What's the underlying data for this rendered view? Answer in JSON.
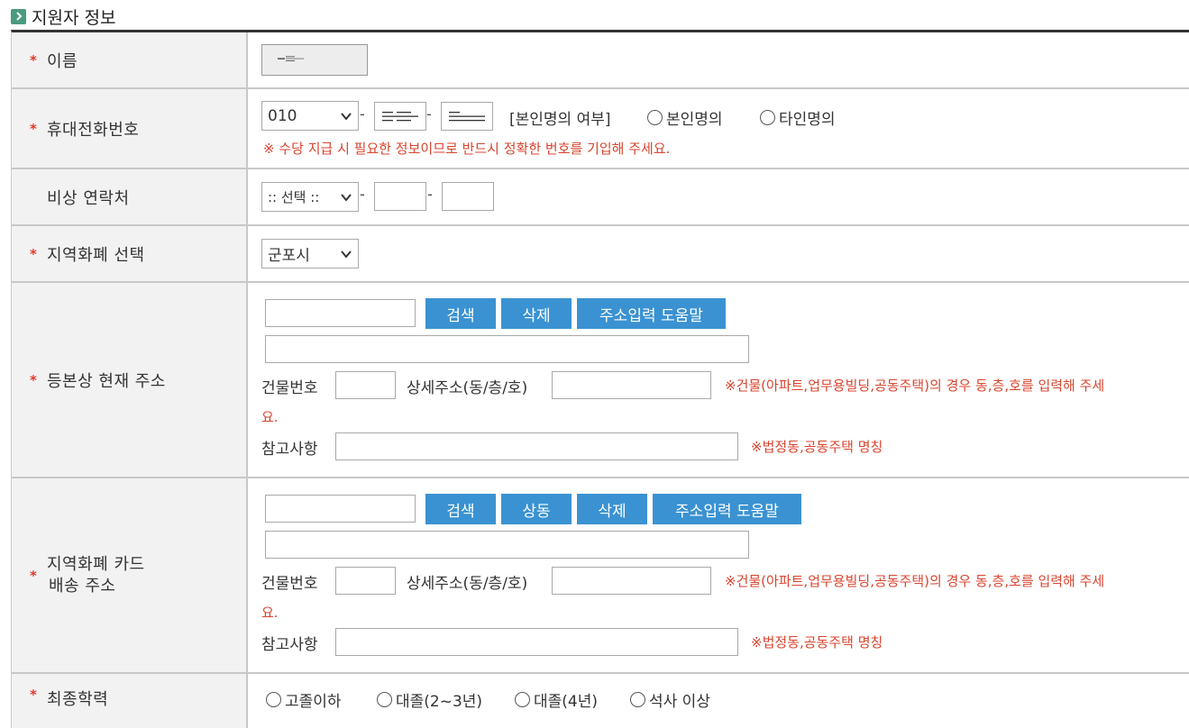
{
  "section": {
    "title": "지원자 정보"
  },
  "rows": {
    "name": {
      "label": "이름"
    },
    "phone": {
      "label": "휴대전화번호",
      "prefix": "010",
      "owner_label": "[본인명의 여부]",
      "owner_options": [
        "본인명의",
        "타인명의"
      ],
      "note": "※ 수당 지급 시 필요한 정보이므로 반드시 정확한 번호를 기입해 주세요."
    },
    "emergency": {
      "label": "비상 연락처",
      "prefix": ":: 선택 ::"
    },
    "currency": {
      "label": "지역화폐 선택",
      "selected": "군포시"
    },
    "address": {
      "label": "등본상 현재 주소",
      "buttons": [
        "검색",
        "삭제",
        "주소입력 도움말"
      ],
      "building_label": "건물번호",
      "detail_label": "상세주소(동/층/호)",
      "detail_note_1": "※건물(아파트,업무용빌딩,공동주택)의 경우 동,층,호를 입력해 주세",
      "detail_note_2": "요.",
      "ref_label": "참고사항",
      "ref_note": "※법정동,공동주택 명칭"
    },
    "card": {
      "label_1": "지역화폐 카드",
      "label_2": "배송 주소",
      "buttons": [
        "검색",
        "상동",
        "삭제",
        "주소입력 도움말"
      ],
      "building_label": "건물번호",
      "detail_label": "상세주소(동/층/호)",
      "detail_note_1": "※건물(아파트,업무용빌딩,공동주택)의 경우 동,층,호를 입력해 주세",
      "detail_note_2": "요.",
      "ref_label": "참고사항",
      "ref_note": "※법정동,공동주택 명칭"
    },
    "education": {
      "label": "최종학력",
      "options": [
        "고졸이하",
        "대졸(2~3년)",
        "대졸(4년)",
        "석사 이상"
      ]
    }
  },
  "required_mark": "*"
}
